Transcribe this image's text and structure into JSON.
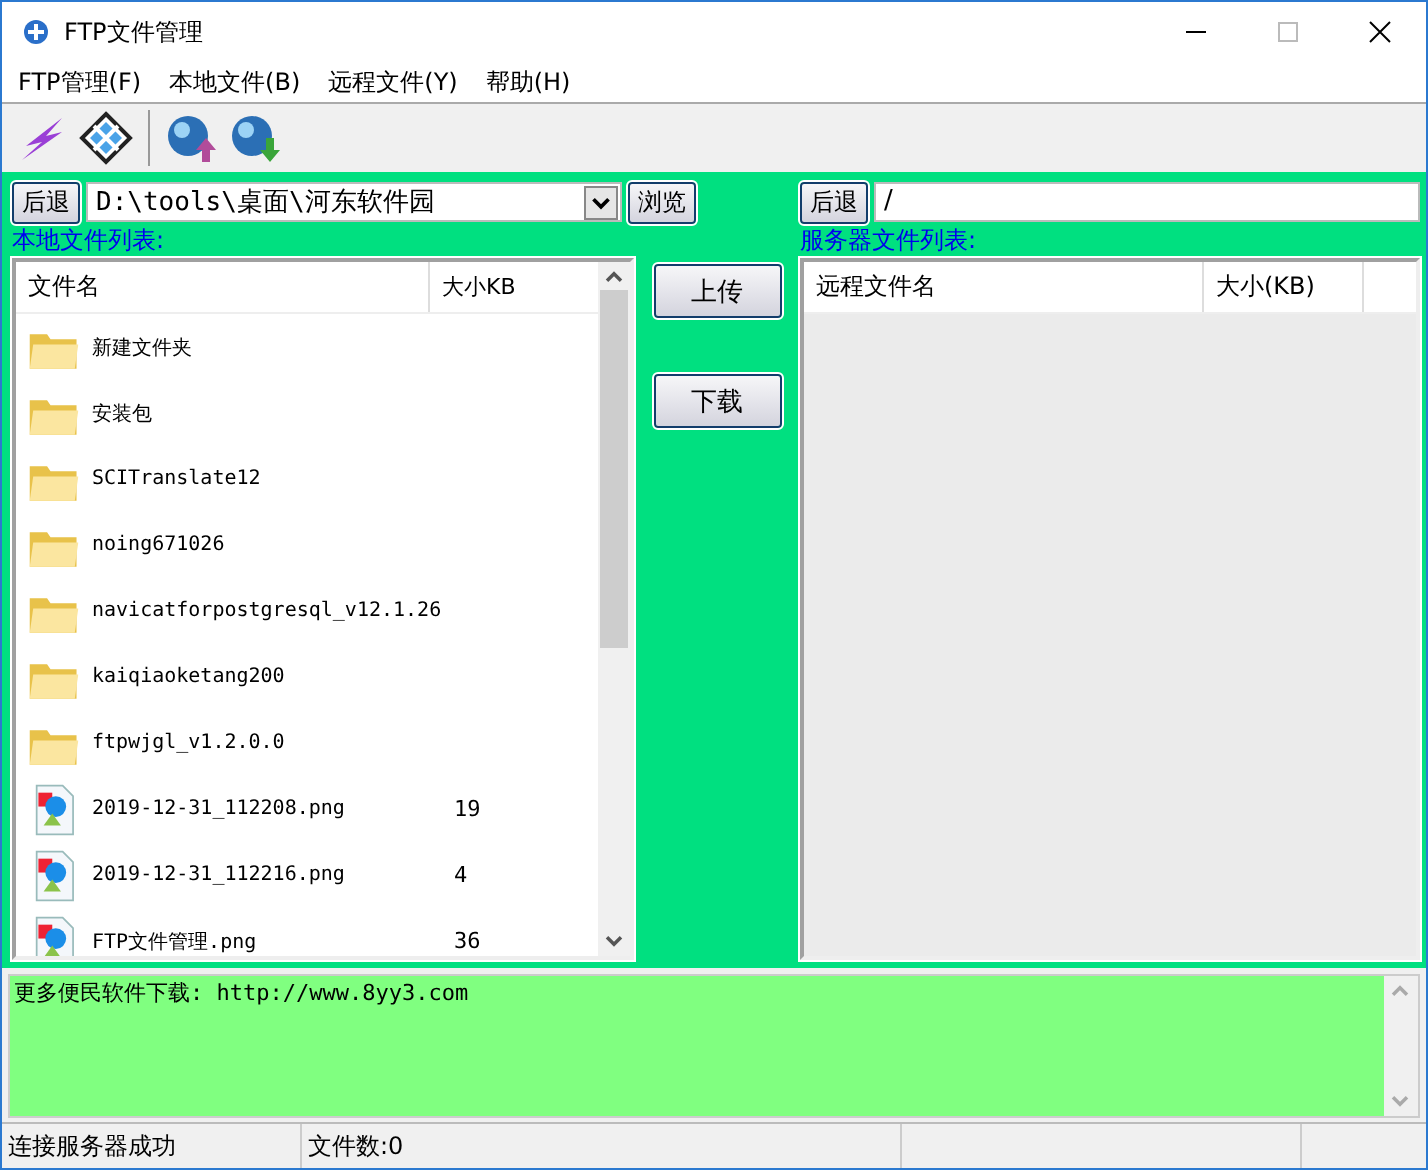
{
  "window": {
    "title": "FTP文件管理"
  },
  "menu": [
    "FTP管理(F)",
    "本地文件(B)",
    "远程文件(Y)",
    "帮助(H)"
  ],
  "toolbar": [
    {
      "kind": "connect"
    },
    {
      "kind": "disconnect"
    },
    {
      "kind": "upload"
    },
    {
      "kind": "download"
    }
  ],
  "local": {
    "back_button": "后退",
    "path": "D:\\tools\\桌面\\河东软件园",
    "browse_button": "浏览",
    "label": "本地文件列表:",
    "columns": [
      "文件名",
      "大小KB"
    ],
    "rows": [
      {
        "kind": "folder",
        "name": "新建文件夹"
      },
      {
        "kind": "folder",
        "name": "安装包"
      },
      {
        "kind": "folder",
        "name": "SCITranslate12"
      },
      {
        "kind": "folder",
        "name": "noing671026"
      },
      {
        "kind": "folder",
        "name": "navicatforpostgresql_v12.1.26"
      },
      {
        "kind": "folder",
        "name": "kaiqiaoketang200"
      },
      {
        "kind": "folder",
        "name": "ftpwjgl_v1.2.0.0"
      },
      {
        "kind": "image",
        "name": "2019-12-31_112208.png",
        "size": "19"
      },
      {
        "kind": "image",
        "name": "2019-12-31_112216.png",
        "size": "4"
      },
      {
        "kind": "image",
        "name": "FTP文件管理.png",
        "size": "36"
      }
    ]
  },
  "transfer_buttons": [
    "上传",
    "下载"
  ],
  "remote": {
    "back_button": "后退",
    "path": "/",
    "label": "服务器文件列表:",
    "columns": [
      "远程文件名",
      "大小(KB)"
    ]
  },
  "log": "更多便民软件下载: http://www.8yy3.com",
  "status_bar": [
    "连接服务器成功",
    "文件数:0"
  ]
}
